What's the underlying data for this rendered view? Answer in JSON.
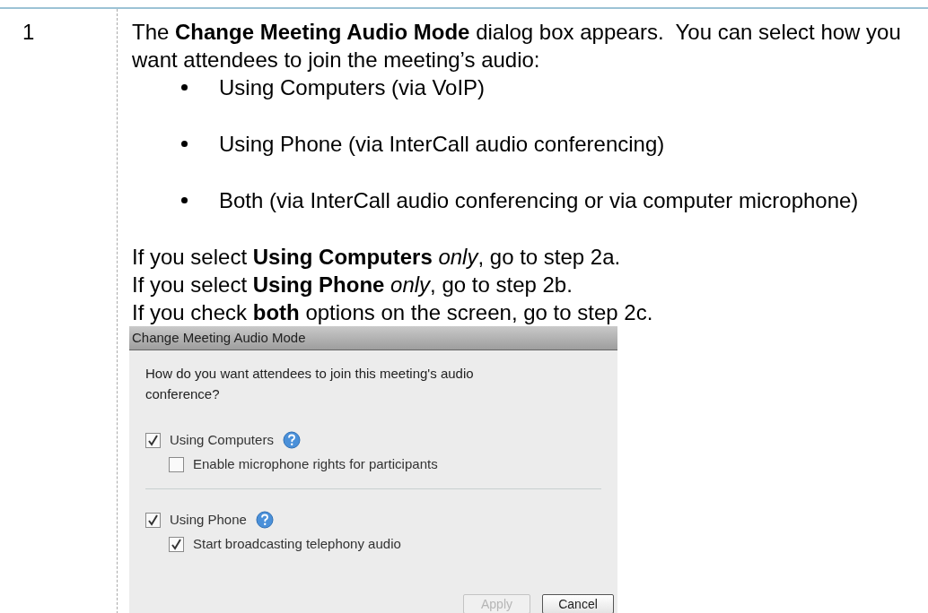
{
  "step": {
    "number": "1",
    "intro": "The **Change Meeting Audio Mode** dialog box appears.  You can select how you want attendees to join the meeting’s audio:",
    "bullets": [
      "Using Computers (via VoIP)",
      "Using Phone (via InterCall audio conferencing)",
      "Both (via InterCall audio conferencing or via computer microphone)"
    ],
    "conditions": [
      "If you select **Using Computers** *only*, go to step 2a.",
      "If you select **Using Phone** *only*, go to step 2b.",
      "If you check **both** options on the screen, go to step 2c."
    ]
  },
  "dialog": {
    "title": "Change Meeting Audio Mode",
    "question": "How do you want attendees to join this meeting's audio conference?",
    "options": [
      {
        "label": "Using Computers",
        "checked": true,
        "help": true,
        "children": [
          {
            "label": "Enable microphone rights for participants",
            "checked": false
          }
        ]
      },
      {
        "label": "Using Phone",
        "checked": true,
        "help": true,
        "children": [
          {
            "label": "Start broadcasting telephony audio",
            "checked": true
          }
        ]
      }
    ],
    "buttons": [
      {
        "label": "Apply",
        "disabled": true
      },
      {
        "label": "Cancel",
        "disabled": false
      }
    ]
  }
}
